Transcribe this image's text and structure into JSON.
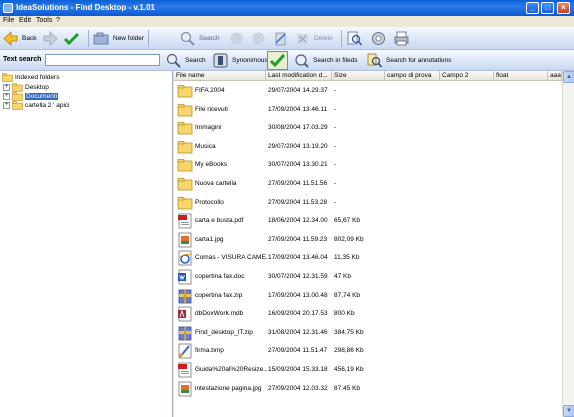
{
  "window": {
    "title": "IdeaSolutions - Find Desktop - v.1.01",
    "minimize": "_",
    "maximize": "□",
    "close": "×"
  },
  "menu": [
    "File",
    "Edit",
    "Tools",
    "?"
  ],
  "toolbar": {
    "back": "Back",
    "new_folder": "New folder",
    "search": "Search",
    "delete": "Delete"
  },
  "search_bar": {
    "label": "Text search",
    "input_value": "",
    "search": "Search",
    "synonymous": "Synonimous",
    "search_fields": "Search in fileds",
    "search_annotations": "Search for annotations"
  },
  "tree": {
    "root": "Indexed folders",
    "items": [
      "Desktop",
      "Documenti",
      "cartella 2 ' apici"
    ],
    "selected": "Documenti"
  },
  "columns": [
    "File name",
    "Last modification d...",
    "Size",
    "campo di prova",
    "Campo 2",
    "float",
    "aaa"
  ],
  "files": [
    {
      "name": "FIFA 2004",
      "date": "29/07/2004 14.29.37",
      "size": "-",
      "icon": "folder-icon"
    },
    {
      "name": "File ricevuti",
      "date": "17/09/2004 13.46.11",
      "size": "-",
      "icon": "folder-icon"
    },
    {
      "name": "Immagini",
      "date": "30/08/2004 17.03.29",
      "size": "-",
      "icon": "folder-icon"
    },
    {
      "name": "Musica",
      "date": "29/07/2004 13.19.20",
      "size": "-",
      "icon": "folder-icon"
    },
    {
      "name": "My eBooks",
      "date": "30/07/2004 13.30.21",
      "size": "-",
      "icon": "folder-icon"
    },
    {
      "name": "Nuova cartella",
      "date": "27/09/2004 11.51.56",
      "size": "-",
      "icon": "folder-icon"
    },
    {
      "name": "Protocollo",
      "date": "27/09/2004 11.53.28",
      "size": "-",
      "icon": "folder-icon"
    },
    {
      "name": "carta e busta.pdf",
      "date": "18/06/2004 12.34.00",
      "size": "65,67 Kb",
      "icon": "pdf-icon"
    },
    {
      "name": "carta1.jpg",
      "date": "27/09/2004 11.59.23",
      "size": "802,09 Kb",
      "icon": "image-icon"
    },
    {
      "name": "Comas - VISURA CAME...",
      "date": "17/09/2004 13.46.04",
      "size": "11,35 Kb",
      "icon": "ie-icon"
    },
    {
      "name": "copertina fax.doc",
      "date": "30/07/2004 12.31.59",
      "size": "47 Kb",
      "icon": "word-icon"
    },
    {
      "name": "copertina fax.zip",
      "date": "17/09/2004 13.00.48",
      "size": "87,74 Kb",
      "icon": "zip-icon"
    },
    {
      "name": "dbDoxWork.mdb",
      "date": "16/09/2004 20.17.53",
      "size": "800 Kb",
      "icon": "access-icon"
    },
    {
      "name": "Find_desktop_IT.zip",
      "date": "31/08/2004 12.31.46",
      "size": "384,75 Kb",
      "icon": "zip-icon"
    },
    {
      "name": "firma.bmp",
      "date": "27/09/2004 11.51.47",
      "size": "298,86 Kb",
      "icon": "paint-icon"
    },
    {
      "name": "Guida%20al%20Resize...",
      "date": "15/09/2004 15.33.18",
      "size": "456,19 Kb",
      "icon": "pdf-icon"
    },
    {
      "name": "intestazione pagina.jpg",
      "date": "27/09/2004 12.03.32",
      "size": "87,45 Kb",
      "icon": "image-icon"
    }
  ],
  "colors": {
    "selection": "#316AC5",
    "titlebar": "#0A5FD8",
    "folder": "#F7D56B",
    "toolbar": "#C9D8F3"
  }
}
